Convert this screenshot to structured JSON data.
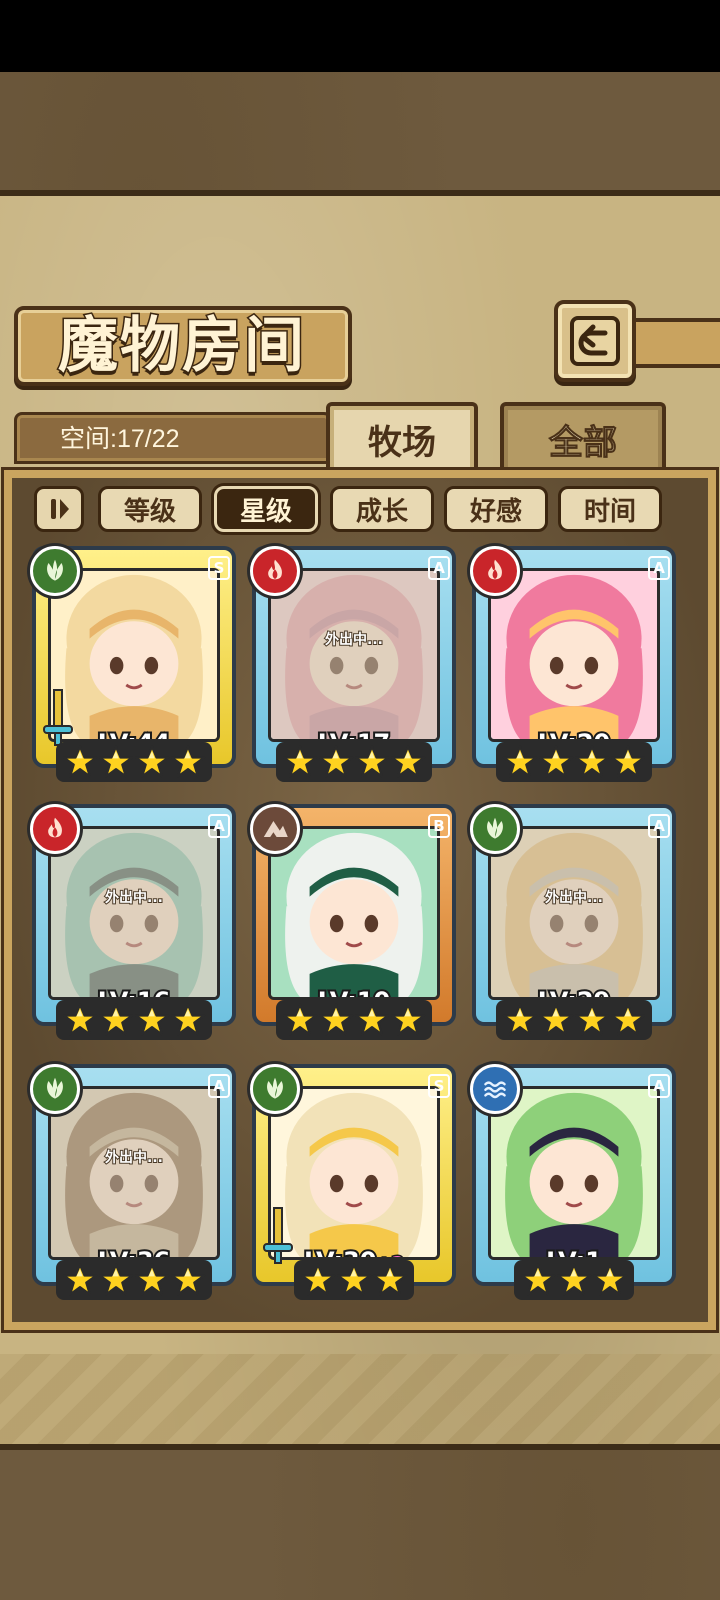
{
  "title": "魔物房间",
  "space_label": "空间:17/22",
  "tabs": [
    {
      "label": "牧场",
      "active": true
    },
    {
      "label": "全部",
      "active": false
    }
  ],
  "sort_buttons": [
    {
      "label": "等级",
      "active": false
    },
    {
      "label": "星级",
      "active": true
    },
    {
      "label": "成长",
      "active": false
    },
    {
      "label": "好感",
      "active": false
    },
    {
      "label": "时间",
      "active": false
    }
  ],
  "cards": [
    {
      "element": "leaf",
      "rank": "S",
      "frame": "gold",
      "level": "LV:44",
      "bonus": "",
      "stars": 4,
      "away": "",
      "weapon": true,
      "palette": [
        "#f3d9a0",
        "#e8b56a",
        "#fff0c8"
      ]
    },
    {
      "element": "fire",
      "rank": "A",
      "frame": "blue",
      "level": "LV:17",
      "bonus": "",
      "stars": 4,
      "away": "外出中...",
      "weapon": false,
      "palette": [
        "#e8a0b0",
        "#c98aa2",
        "#f7d6dc"
      ]
    },
    {
      "element": "fire",
      "rank": "A",
      "frame": "blue",
      "level": "LV:20",
      "bonus": "",
      "stars": 4,
      "away": "",
      "weapon": false,
      "palette": [
        "#f07a9e",
        "#ffc46b",
        "#ffd0de"
      ]
    },
    {
      "element": "fire",
      "rank": "A",
      "frame": "blue",
      "level": "LV:16",
      "bonus": "",
      "stars": 4,
      "away": "外出中...",
      "weapon": false,
      "palette": [
        "#7ec8b8",
        "#3b5a5a",
        "#cfe9e0"
      ]
    },
    {
      "element": "earth",
      "rank": "B",
      "frame": "bronze",
      "level": "LV:10",
      "bonus": "",
      "stars": 4,
      "away": "",
      "weapon": false,
      "palette": [
        "#eef2ee",
        "#1f5e45",
        "#a8e0c0"
      ]
    },
    {
      "element": "leaf",
      "rank": "A",
      "frame": "blue",
      "level": "LV:29",
      "bonus": "",
      "stars": 4,
      "away": "外出中...",
      "weapon": false,
      "palette": [
        "#e8c27a",
        "#c9c0b0",
        "#f5e6c6"
      ]
    },
    {
      "element": "leaf",
      "rank": "A",
      "frame": "blue",
      "level": "LV:36",
      "bonus": "",
      "stars": 4,
      "away": "外出中...",
      "weapon": false,
      "palette": [
        "#8a6a4a",
        "#c2b090",
        "#e0d4bc"
      ]
    },
    {
      "element": "leaf",
      "rank": "S",
      "frame": "gold",
      "level": "LV:30",
      "bonus": "+2",
      "stars": 3,
      "away": "",
      "weapon": true,
      "palette": [
        "#f2e2b8",
        "#f5c84a",
        "#fff6dc"
      ]
    },
    {
      "element": "water",
      "rank": "A",
      "frame": "blue",
      "level": "LV:1",
      "bonus": "",
      "stars": 3,
      "away": "",
      "weapon": false,
      "palette": [
        "#8ed07a",
        "#2a2640",
        "#dff5c6"
      ]
    }
  ]
}
